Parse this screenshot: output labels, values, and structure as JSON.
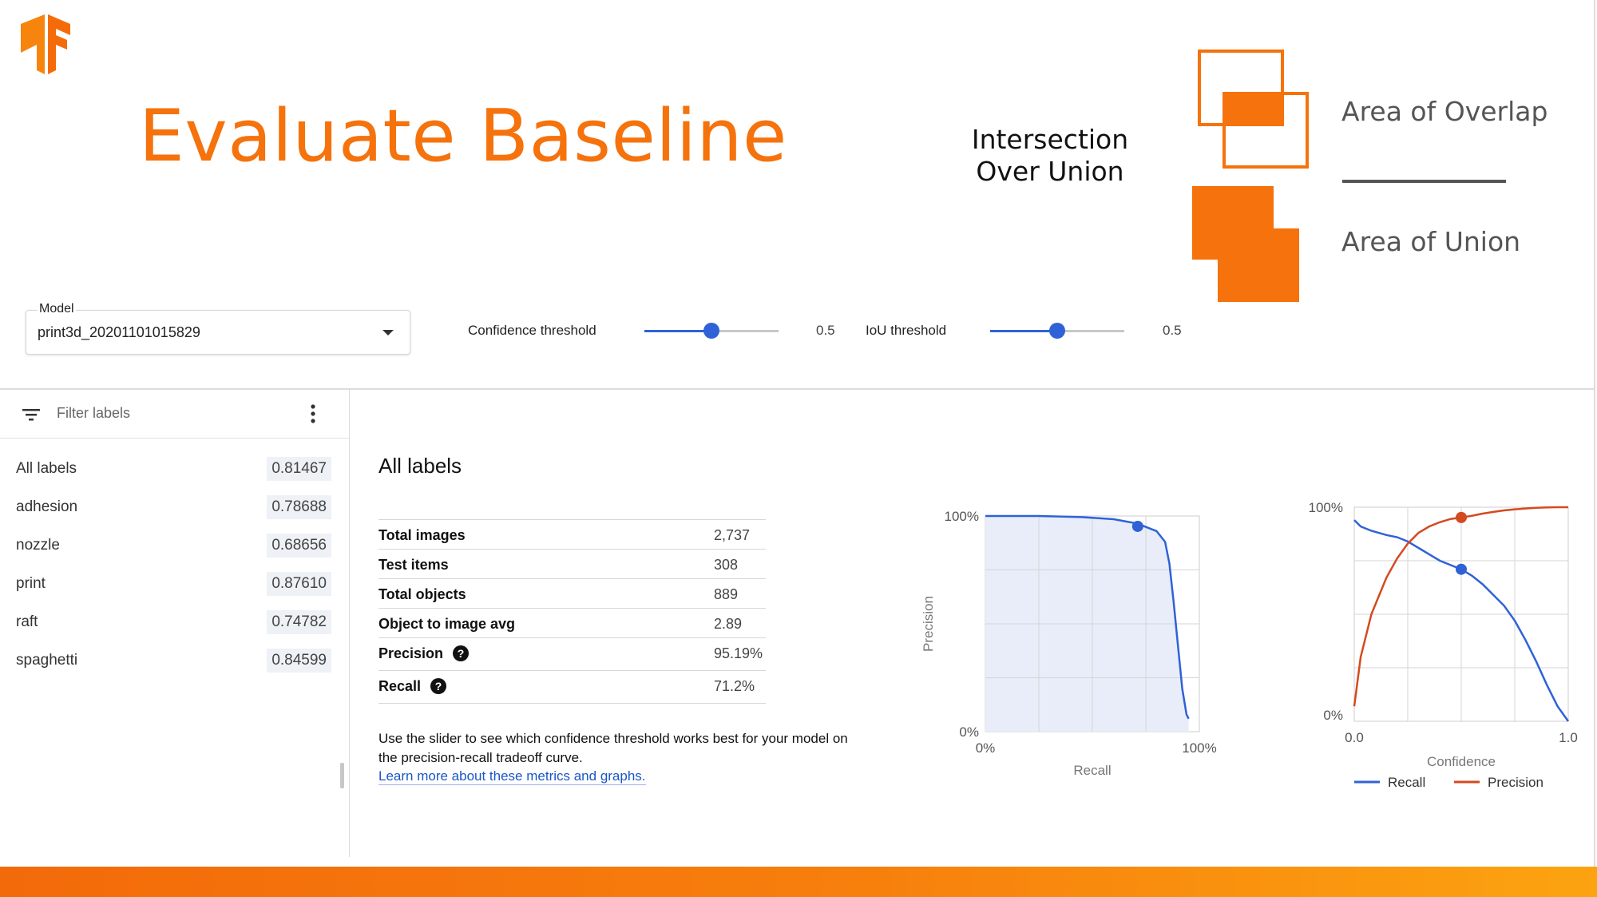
{
  "slide": {
    "title": "Evaluate Baseline",
    "iou_label": "Intersection Over Union",
    "overlap_text": "Area of Overlap",
    "union_text": "Area of Union",
    "brand_color": "#f5720c",
    "logo_icon": "tensorflow-logo"
  },
  "controls": {
    "model_label": "Model",
    "model_value": "print3d_20201101015829",
    "confidence_label": "Confidence threshold",
    "confidence_value": "0.5",
    "confidence_fraction": 0.5,
    "iou_label": "IoU threshold",
    "iou_value": "0.5",
    "iou_fraction": 0.5
  },
  "sidebar": {
    "filter_placeholder": "Filter labels",
    "labels": [
      {
        "name": "All labels",
        "score": "0.81467"
      },
      {
        "name": "adhesion",
        "score": "0.78688"
      },
      {
        "name": "nozzle",
        "score": "0.68656"
      },
      {
        "name": "print",
        "score": "0.87610"
      },
      {
        "name": "raft",
        "score": "0.74782"
      },
      {
        "name": "spaghetti",
        "score": "0.84599"
      }
    ]
  },
  "main": {
    "title": "All labels",
    "stats": [
      {
        "name": "Total images",
        "value": "2,737"
      },
      {
        "name": "Test items",
        "value": "308"
      },
      {
        "name": "Total objects",
        "value": "889"
      },
      {
        "name": "Object to image avg",
        "value": "2.89"
      },
      {
        "name": "Precision",
        "value": "95.19%"
      },
      {
        "name": "Recall",
        "value": "71.2%"
      }
    ],
    "explain_text": "Use the slider to see which confidence threshold works best for your model on the precision-recall tradeoff curve.",
    "learn_more": "Learn more about these metrics and graphs."
  },
  "chart_data": [
    {
      "type": "area",
      "xlabel": "Recall",
      "ylabel": "Precision",
      "x_tick_labels": [
        "0%",
        "100%"
      ],
      "y_tick_labels": [
        "0%",
        "100%"
      ],
      "xlim": [
        0,
        1
      ],
      "ylim": [
        0,
        1
      ],
      "grid": true,
      "line_color": "#2f62d6",
      "fill_color": "#e8edf9",
      "series": [
        {
          "x": [
            0.0,
            0.25,
            0.45,
            0.6,
            0.71,
            0.8,
            0.84,
            0.86,
            0.88,
            0.9,
            0.92,
            0.94,
            0.95
          ],
          "y": [
            1.0,
            1.0,
            0.995,
            0.985,
            0.965,
            0.93,
            0.88,
            0.78,
            0.6,
            0.4,
            0.2,
            0.08,
            0.06
          ]
        }
      ],
      "highlight_point": {
        "x": 0.712,
        "y": 0.952
      }
    },
    {
      "type": "line",
      "xlabel": "Confidence",
      "x_tick_labels": [
        "0.0",
        "1.0"
      ],
      "y_tick_labels": [
        "0%",
        "100%"
      ],
      "xlim": [
        0,
        1
      ],
      "ylim": [
        0,
        1
      ],
      "grid": true,
      "legend_position": "bottom",
      "x": [
        0.0,
        0.03,
        0.08,
        0.15,
        0.2,
        0.25,
        0.3,
        0.35,
        0.4,
        0.45,
        0.5,
        0.55,
        0.6,
        0.65,
        0.7,
        0.75,
        0.8,
        0.85,
        0.9,
        0.95,
        1.0
      ],
      "series": [
        {
          "name": "Recall",
          "color": "#2f62d6",
          "values": [
            0.94,
            0.91,
            0.89,
            0.87,
            0.86,
            0.84,
            0.81,
            0.78,
            0.75,
            0.73,
            0.71,
            0.68,
            0.64,
            0.59,
            0.54,
            0.47,
            0.38,
            0.28,
            0.17,
            0.07,
            0.0
          ]
        },
        {
          "name": "Precision",
          "color": "#d44a1f",
          "values": [
            0.07,
            0.3,
            0.5,
            0.67,
            0.76,
            0.83,
            0.88,
            0.91,
            0.93,
            0.945,
            0.952,
            0.96,
            0.97,
            0.978,
            0.985,
            0.99,
            0.994,
            0.997,
            0.999,
            1.0,
            1.0
          ]
        }
      ],
      "highlight_x": 0.5
    }
  ]
}
